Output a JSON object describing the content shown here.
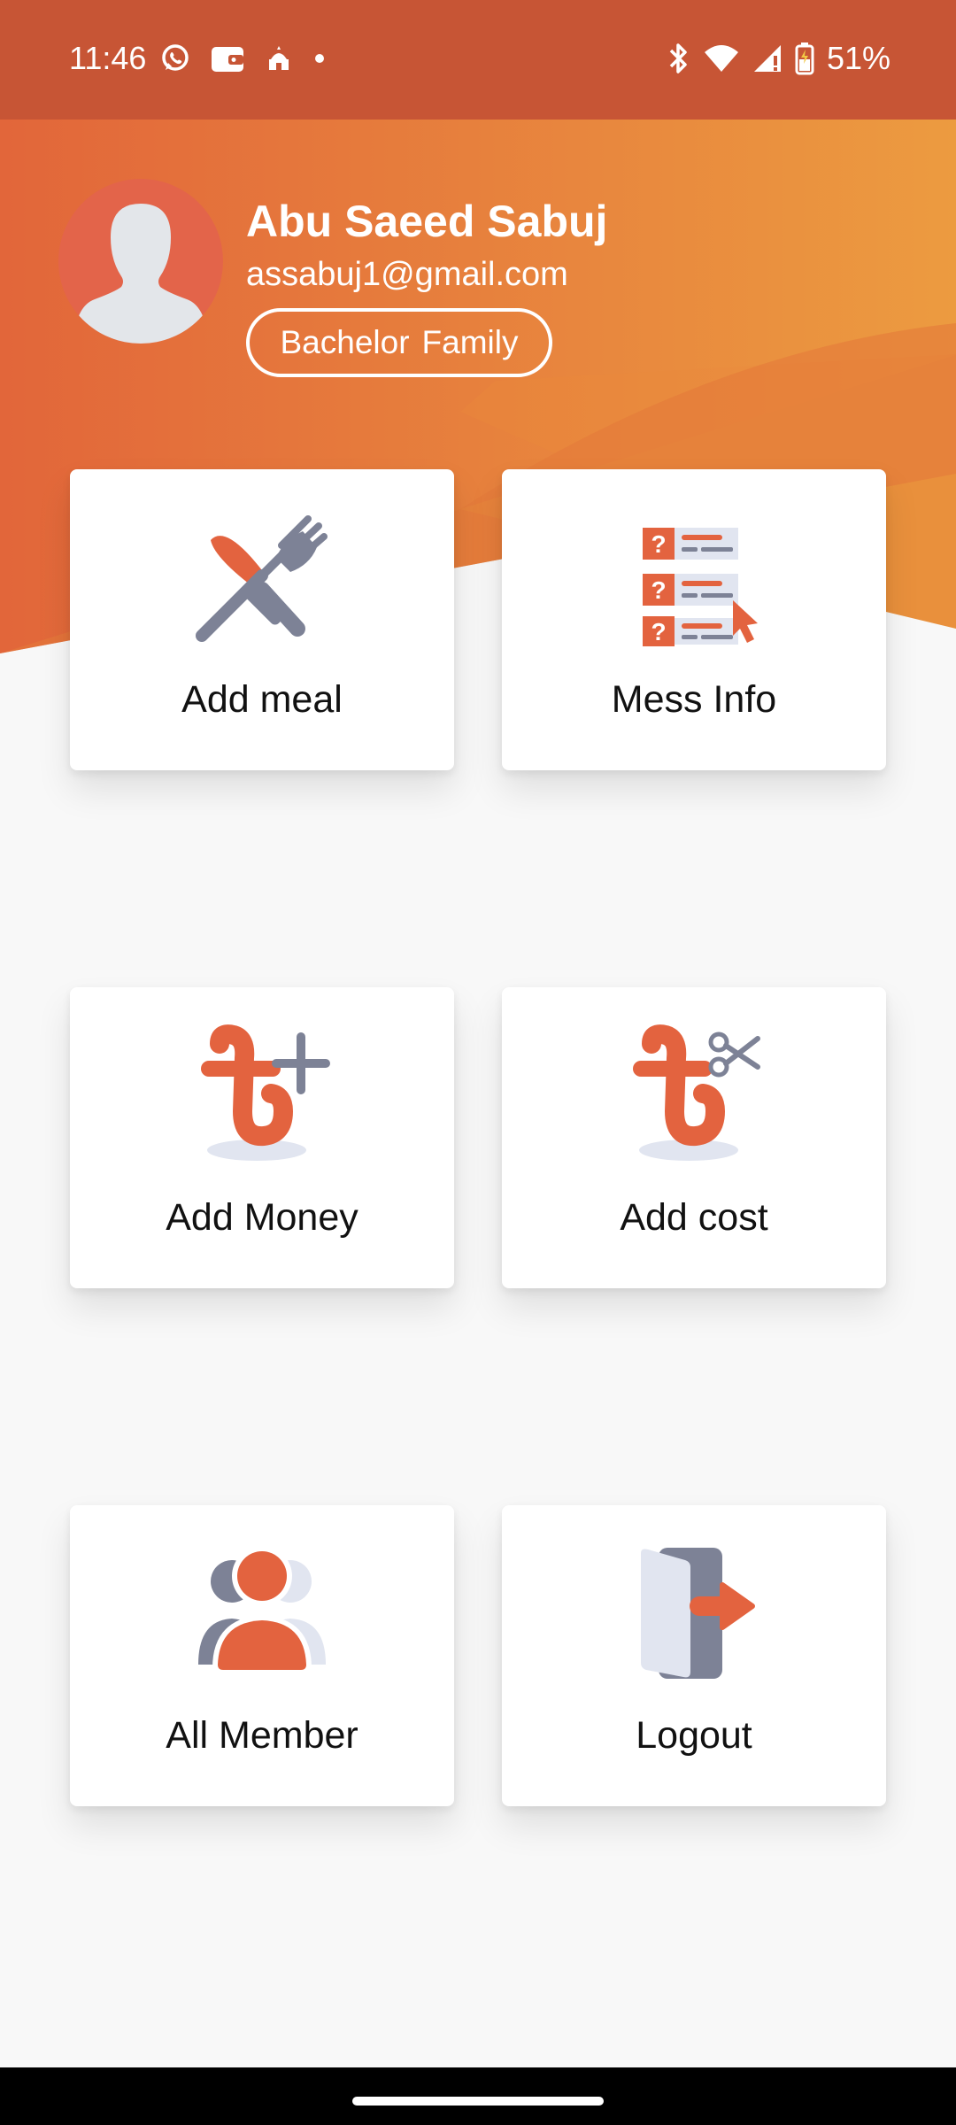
{
  "status_bar": {
    "time": "11:46",
    "battery_percent": "51%",
    "left_icons": [
      "whatsapp-icon",
      "wallet-icon",
      "mosque-icon",
      "dot-icon"
    ],
    "right_icons": [
      "bluetooth-icon",
      "wifi-icon",
      "signal-icon",
      "battery-icon"
    ]
  },
  "profile": {
    "name": "Abu Saeed Sabuj",
    "email": "assabuj1@gmail.com",
    "mode_options": [
      "Bachelor",
      "Family"
    ]
  },
  "menu": [
    {
      "label": "Add meal",
      "icon": "knife-fork-icon"
    },
    {
      "label": "Mess Info",
      "icon": "question-list-icon"
    },
    {
      "label": "Add Money",
      "icon": "taka-plus-icon"
    },
    {
      "label": "Add cost",
      "icon": "taka-scissors-icon"
    },
    {
      "label": "All Member",
      "icon": "group-members-icon"
    },
    {
      "label": "Logout",
      "icon": "logout-door-icon"
    }
  ],
  "colors": {
    "status_bar": "#c75535",
    "accent": "#e3633f",
    "header_gradient_start": "#e2663a",
    "header_gradient_end": "#ec9b40",
    "icon_gray": "#7d8296",
    "background": "#f8f8f8"
  }
}
